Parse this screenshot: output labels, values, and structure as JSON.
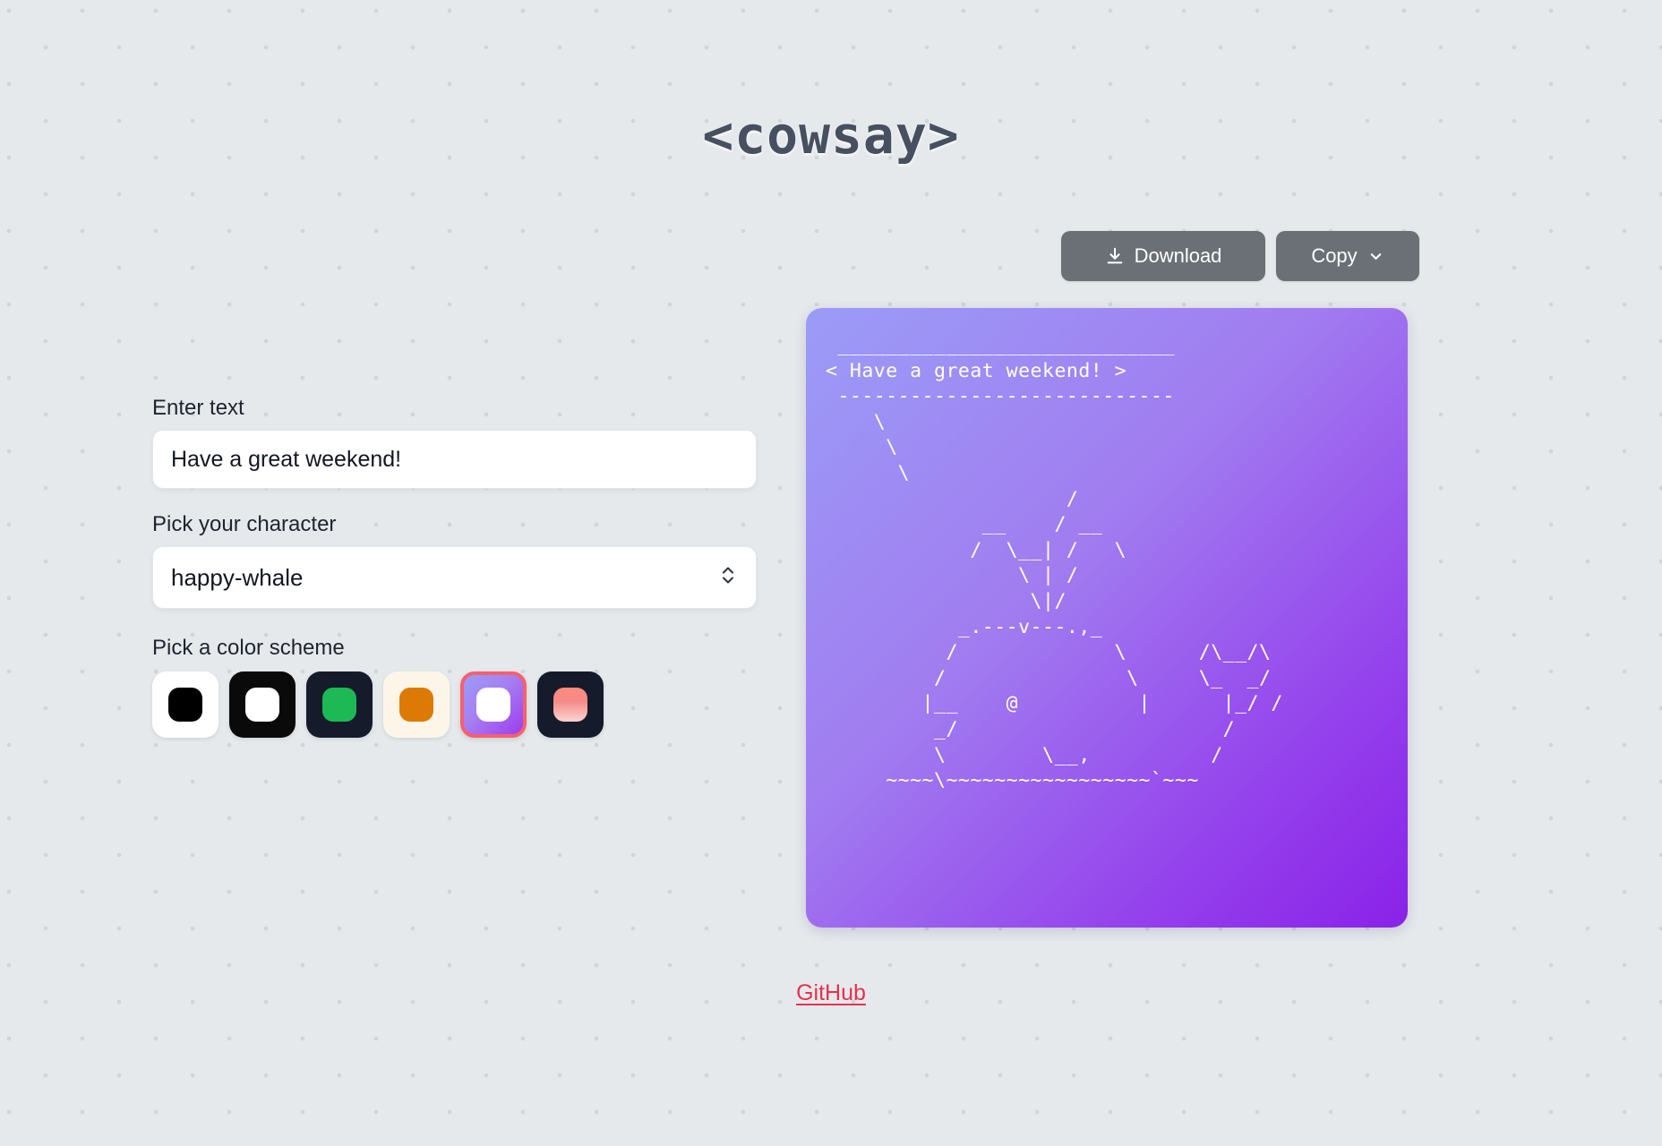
{
  "app": {
    "title": "<cowsay>"
  },
  "toolbar": {
    "download_label": "Download",
    "copy_label": "Copy",
    "download_icon": "download-icon",
    "copy_chevron_icon": "chevron-down-icon"
  },
  "form": {
    "text_label": "Enter text",
    "text_value": "Have a great weekend!",
    "text_placeholder": "Enter text",
    "character_label": "Pick your character",
    "character_value": "happy-whale",
    "color_label": "Pick a color scheme"
  },
  "color_schemes": [
    {
      "name": "white-black",
      "bg": "#ffffff",
      "dot": "#000000",
      "dot_gradient": "",
      "selected": false
    },
    {
      "name": "black-white",
      "bg": "#0a0a0a",
      "dot": "#ffffff",
      "dot_gradient": "",
      "selected": false
    },
    {
      "name": "navy-green",
      "bg": "#161b2b",
      "dot": "#1db954",
      "dot_gradient": "",
      "selected": false
    },
    {
      "name": "cream-orange",
      "bg": "#fdf6e8",
      "dot": "#dd7a05",
      "dot_gradient": "",
      "selected": false
    },
    {
      "name": "purple-white",
      "bg": "linear-gradient(135deg,#9b9cf7 0%,#a77ef2 45%,#9b3ced 100%)",
      "dot": "#ffffff",
      "dot_gradient": "",
      "selected": true
    },
    {
      "name": "navy-coral",
      "bg": "#161b2b",
      "dot": "",
      "dot_gradient": "linear-gradient(180deg,#ff8b7a 0%,#f58a8a 40%,#fbd4d0 100%)",
      "selected": false
    }
  ],
  "preview": {
    "gradient_from": "#9b9cf7",
    "gradient_to": "#8a22e8",
    "text_color": "#ffffff",
    "bubble_text": "< Have a great weekend! >",
    "ascii_art": " ___________________________\n< Have a great weekend! >\n ---------------------------\n    \\\n     \\\n      \\\n                    __\n           __     /  \\     __\n          /  \\   /    \\   /  \\\n               \\  | /\n              \\ | /\n          _.---v---.,_\n        /             \\      /\\__/\\\n       /               \\     \\_  _/\n      |__     @         |      |_/ /\n       _/                      /\n      \\          \\__,         /\n  ~~~~\\~~~~~~~~~~~~~~~~~`~~~"
  },
  "footer": {
    "github_label": "GitHub",
    "github_color": "#e8304f"
  }
}
